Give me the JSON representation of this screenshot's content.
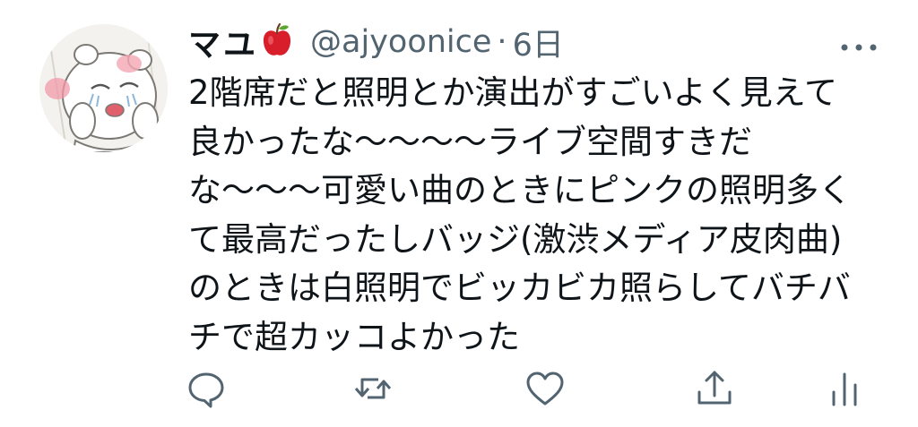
{
  "tweet": {
    "display_name": "マユ",
    "name_emoji_icon": "red-apple-icon",
    "handle": "@ajyoonice",
    "separator": "·",
    "time": "6日",
    "text_lines": [
      "2階席だと照明とか演出がすごいよく見えて",
      "良かったな〜〜〜〜ライブ空間すきだ",
      "な〜〜〜可愛い曲のときにピンクの照明多く",
      "て最高だったしバッジ(激渋メディア皮肉曲)",
      "のときは白照明でビッカビカ照らしてバチバ",
      "チで超カッコよかった"
    ]
  },
  "icons": {
    "more": "more-icon",
    "reply": "reply-icon",
    "retweet": "retweet-icon",
    "like": "heart-icon",
    "share": "share-icon",
    "analytics": "analytics-icon"
  },
  "colors": {
    "text": "#0f1419",
    "secondary": "#536471",
    "apple_red": "#d81e2b"
  }
}
